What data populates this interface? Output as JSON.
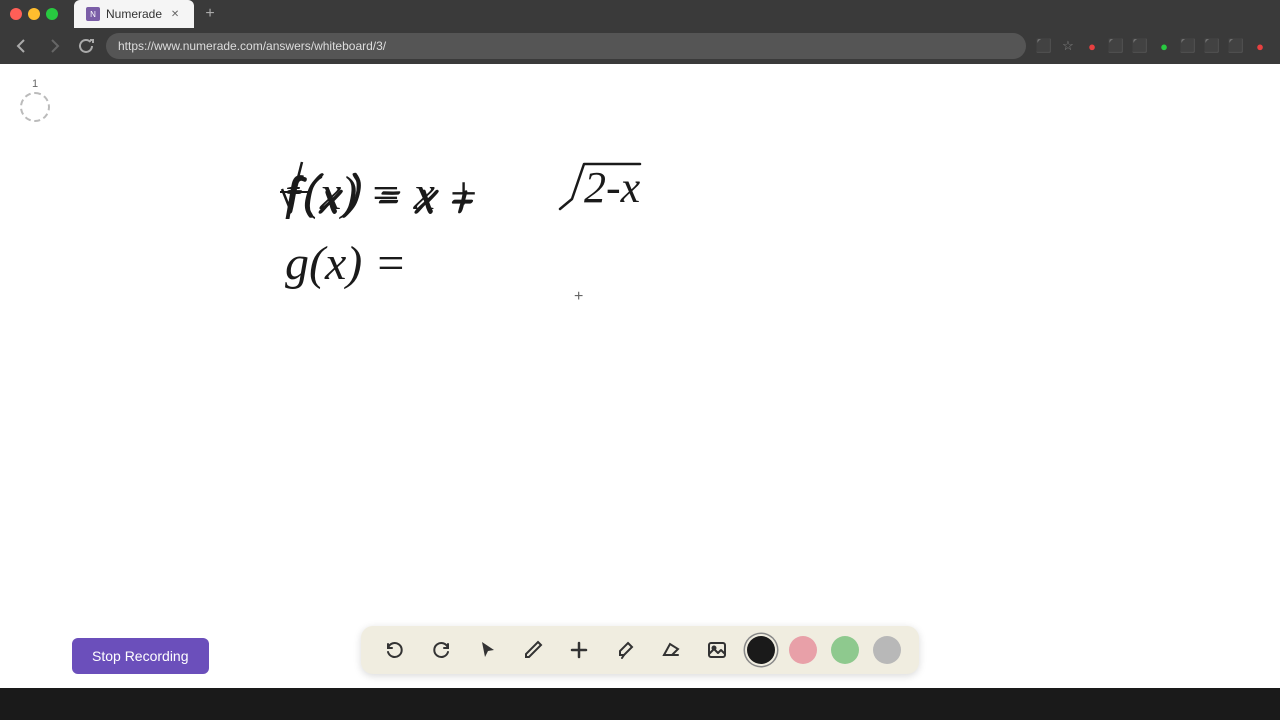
{
  "browser": {
    "tab_title": "Numerade",
    "tab_favicon": "N",
    "url": "https://www.numerade.com/answers/whiteboard/3/",
    "nav_buttons": {
      "back": "←",
      "forward": "→",
      "refresh": "↻"
    }
  },
  "whiteboard": {
    "page_number": "1",
    "math_line1": "f(x) = x + √(2-x)",
    "math_line2": "g(x) ="
  },
  "toolbar": {
    "undo_label": "undo",
    "redo_label": "redo",
    "pointer_label": "pointer",
    "pen_label": "pen",
    "add_label": "add",
    "highlighter_label": "highlighter",
    "eraser_label": "eraser",
    "image_label": "image",
    "colors": {
      "black": "#1a1a1a",
      "pink": "#e88fa0",
      "green": "#8ec98e",
      "gray": "#b0b0b0"
    },
    "active_color": "black"
  },
  "recording": {
    "button_label": "Stop Recording"
  }
}
